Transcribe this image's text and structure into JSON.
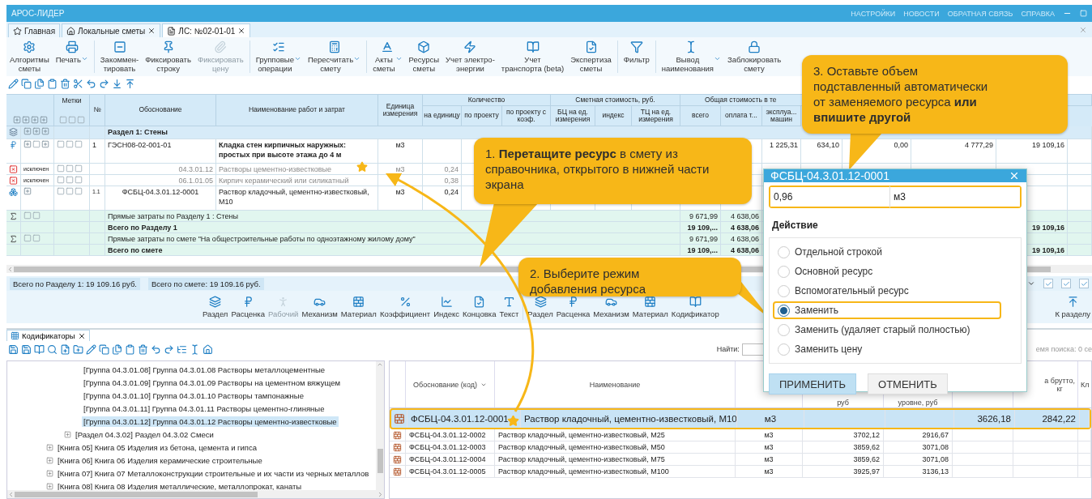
{
  "title_bar": {
    "title": "АРОС-ЛИДЕР",
    "menu": [
      "НАСТРОЙКИ",
      "НОВОСТИ",
      "ОБРАТНАЯ СВЯЗЬ",
      "СПРАВКА"
    ]
  },
  "tabs": [
    {
      "label": "Главная",
      "kind": "star",
      "closable": false,
      "selected": false
    },
    {
      "label": "Локальные сметы",
      "kind": "home",
      "closable": true,
      "selected": false
    },
    {
      "label": "ЛС: №02-01-01",
      "kind": "document",
      "closable": true,
      "selected": true
    }
  ],
  "ribbon": [
    {
      "label": "Алгоритмы\nсметы",
      "kind": "gear",
      "dropdown": false,
      "disabled": false
    },
    {
      "label": "Печать",
      "kind": "printer",
      "dropdown": true,
      "disabled": false
    },
    {
      "kind": "separator"
    },
    {
      "label": "Закоммен-\nтировать",
      "kind": "comment",
      "dropdown": false,
      "disabled": false
    },
    {
      "label": "Фиксировать\nстроку",
      "kind": "pin",
      "dropdown": false,
      "disabled": false
    },
    {
      "label": "Фиксировать\nцену",
      "kind": "clip",
      "dropdown": false,
      "disabled": true
    },
    {
      "kind": "separator"
    },
    {
      "label": "Групповые\nоперации",
      "kind": "list",
      "dropdown": true,
      "disabled": false
    },
    {
      "label": "Пересчитать\nсмету",
      "kind": "calc",
      "dropdown": true,
      "disabled": false
    },
    {
      "kind": "separator"
    },
    {
      "label": "Акты\nсметы",
      "kind": "letter",
      "dropdown": true,
      "disabled": false
    },
    {
      "label": "Ресурсы\nсметы",
      "kind": "box",
      "dropdown": false,
      "disabled": false
    },
    {
      "label": "Учет электро-\nэнергии",
      "kind": "bolt",
      "dropdown": false,
      "disabled": false
    },
    {
      "label": "Учет\nтранспорта (beta)",
      "kind": "book",
      "dropdown": false,
      "disabled": false
    },
    {
      "label": "Экспертиза\nсметы",
      "kind": "doc",
      "dropdown": false,
      "disabled": false
    },
    {
      "kind": "separator"
    },
    {
      "label": "Фильтр",
      "kind": "filter",
      "dropdown": false,
      "disabled": false
    },
    {
      "kind": "separator"
    },
    {
      "label": "Вывод\nнаименования",
      "kind": "cursor",
      "dropdown": true,
      "disabled": false
    },
    {
      "label": "Заблокировать\nсмету",
      "kind": "lock",
      "dropdown": false,
      "disabled": false
    }
  ],
  "table": {
    "columns": [
      "Метки",
      "№",
      "Обоснование",
      "Наименование работ и затрат",
      "Единица измерения"
    ],
    "groups": [
      {
        "label": "Количество",
        "columns": [
          "на единицу",
          "по проекту",
          "по проекту с коэф."
        ]
      },
      {
        "label": "Сметная стоимость, руб.",
        "columns": [
          "БЦ на ед. измерения",
          "индекс",
          "ТЦ на ед. измерения"
        ]
      },
      {
        "label": "Общая стоимость в те",
        "columns": [
          "всего",
          "оплата т...",
          "эксплуа... машин"
        ]
      }
    ],
    "rows": [
      {
        "kind": "section",
        "name": "Раздел 1: Стены"
      },
      {
        "kind": "rate",
        "number": "1",
        "code": "ГЭСН08-02-001-01",
        "name": "Кладка стен кирпичных наружных: простых при высоте этажа до 4 м",
        "unit": "м3",
        "machines": "1 225,31",
        "column_16": "634,10",
        "column_17": "0,00",
        "column_18": "4 777,29",
        "column_19": "19 109,16"
      },
      {
        "kind": "excluded",
        "status": "исключен",
        "code": "04.3.01.12",
        "name": "Растворы цементно-известковые",
        "unit": "м3",
        "per_unit": "0,24"
      },
      {
        "kind": "excluded",
        "status": "исключен",
        "code": "06.1.01.05",
        "name": "Кирпич керамический или силикатный",
        "per_unit": "0,38"
      },
      {
        "kind": "resource",
        "number": "1.1",
        "code": "ФСБЦ-04.3.01.12-0001",
        "name": "Раствор кладочный, цементно-известковый, М10",
        "unit": "м3",
        "per_unit": "0,24"
      },
      {
        "kind": "subtotal",
        "name": "Прямые затраты по Разделу 1 : Стены",
        "total_all": "9 671,99",
        "labor": "4 638,06"
      },
      {
        "kind": "total",
        "name": "Всего по Разделу 1",
        "total_all": "19 109,...",
        "labor": "4 638,06",
        "column_19": "19 109,16"
      },
      {
        "kind": "subtotal",
        "name": "Прямые затраты по смете \"На общестроительные работы по одноэтажному жилому дому\"",
        "total_all": "9 671,99",
        "labor": "4 638,06"
      },
      {
        "kind": "total",
        "name": "Всего по смете",
        "total_all": "19 109,...",
        "labor": "4 638,06",
        "column_19": "19 109,16"
      }
    ]
  },
  "status_bar": [
    "Всего по Разделу 1: 19 109.16 руб.",
    "Всего по смете: 19 109.16 руб."
  ],
  "bottom_ribbon": [
    {
      "label": "Раздел",
      "kind": "layers",
      "disabled": false
    },
    {
      "label": "Расценка",
      "kind": "ruble",
      "disabled": false
    },
    {
      "label": "Рабочий",
      "kind": "worker",
      "disabled": true
    },
    {
      "label": "Механизм",
      "kind": "car",
      "disabled": false
    },
    {
      "label": "Материал",
      "kind": "brick",
      "disabled": false
    },
    {
      "label": "Коэффициент",
      "kind": "percent",
      "disabled": false
    },
    {
      "label": "Индекс",
      "kind": "chart",
      "disabled": false
    },
    {
      "label": "Концовка",
      "kind": "doc",
      "disabled": false
    },
    {
      "label": "Текст",
      "kind": "text",
      "disabled": false
    },
    {
      "kind": "separator"
    },
    {
      "label": "Раздел",
      "kind": "layers",
      "disabled": false
    },
    {
      "label": "Расценка",
      "kind": "ruble",
      "disabled": false
    },
    {
      "label": "Механизм",
      "kind": "car",
      "disabled": false
    },
    {
      "label": "Материал",
      "kind": "brick",
      "disabled": false
    },
    {
      "label": "Кодификатор",
      "kind": "book",
      "disabled": false
    }
  ],
  "bottom_ribbon_right": {
    "label": "К разделу"
  },
  "codifiers": {
    "tab": "Кодификаторы",
    "search_label": "Найти:",
    "search_time": "емя поиска: 0 се",
    "tree": [
      {
        "children": [
          {
            "children": [
              {
                "label": "[Группа 04.3.01.08] Группа 04.3.01.08 Растворы металлоцементные",
                "selected": false
              },
              {
                "label": "[Группа 04.3.01.09] Группа 04.3.01.09 Растворы на цементном вяжущем",
                "selected": false
              },
              {
                "label": "[Группа 04.3.01.10] Группа 04.3.01.10 Растворы тампонажные",
                "selected": false
              },
              {
                "label": "[Группа 04.3.01.11] Группа 04.3.01.11 Растворы цементно-глиняные",
                "selected": false
              },
              {
                "label": "[Группа 04.3.01.12] Группа 04.3.01.12 Растворы цементно-известковые",
                "selected": true
              }
            ]
          },
          {
            "label": "[Раздел 04.3.02] Раздел 04.3.02 Смеси",
            "expanded": false,
            "selected": false
          }
        ]
      },
      {
        "label": "[Книга 05] Книга 05 Изделия из бетона, цемента и гипса",
        "expanded": false,
        "selected": false
      },
      {
        "label": "[Книга 06] Книга 06 Изделия керамические строительные",
        "expanded": false,
        "selected": false
      },
      {
        "label": "[Книга 07] Книга 07 Металлоконструкции строительные и их части из черных металлов",
        "expanded": false,
        "selected": false
      },
      {
        "label": "[Книга 08] Книга 08 Изделия металлические, металлопрокат, канаты",
        "expanded": false,
        "selected": false
      }
    ],
    "grid": {
      "columns": {
        "code": "Обоснование (код)",
        "name": "Наименование",
        "price_1": "руб",
        "price_2": "уровне, руб",
        "weight": "а брутто,\nкг",
        "last": "Кл"
      },
      "rows": [
        {
          "code": "ФСБЦ-04.3.01.12-0001",
          "name": "Раствор кладочный, цементно-известковый, М10",
          "unit": "м3",
          "price_3": "3626,18",
          "weight": "2842,22",
          "selected": true
        },
        {
          "code": "ФСБЦ-04.3.01.12-0002",
          "name": "Раствор кладочный, цементно-известковый, М25",
          "unit": "м3",
          "price_1": "3702,12",
          "price_2": "2916,67",
          "selected": false
        },
        {
          "code": "ФСБЦ-04.3.01.12-0003",
          "name": "Раствор кладочный, цементно-известковый, М50",
          "unit": "м3",
          "price_1": "3859,62",
          "price_2": "3071,08",
          "selected": false
        },
        {
          "code": "ФСБЦ-04.3.01.12-0004",
          "name": "Раствор кладочный, цементно-известковый, М75",
          "unit": "м3",
          "price_1": "3859,62",
          "price_2": "3071,08",
          "selected": false
        },
        {
          "code": "ФСБЦ-04.3.01.12-0005",
          "name": "Раствор кладочный, цементно-известковый, М100",
          "unit": "м3",
          "price_1": "3925,97",
          "price_2": "3136,13",
          "selected": false
        }
      ]
    }
  },
  "callouts": [
    "1. **Перетащите ресурс** в смету из справочника, открытого в нижней части экрана",
    "2. Выберите режим добавления ресурса",
    "3. Оставьте объем подставленный автоматически от заменяемого ресурса **или впишите другой**"
  ],
  "dialog": {
    "title": "ФСБЦ-04.3.01.12-0001",
    "value": "0,96",
    "unit": "м3",
    "section": "Действие",
    "options": [
      {
        "label": "Отдельной строкой",
        "selected": false
      },
      {
        "label": "Основной ресурс",
        "selected": false
      },
      {
        "label": "Вспомогательный ресурс",
        "selected": false
      },
      {
        "label": "Заменить",
        "selected": true
      },
      {
        "label": "Заменить (удаляет старый полностью)",
        "selected": false
      },
      {
        "label": "Заменить цену",
        "selected": false
      }
    ],
    "buttons": [
      {
        "label": "ПРИМЕНИТЬ",
        "primary": true
      },
      {
        "label": "ОТМЕНИТЬ",
        "primary": false
      }
    ]
  }
}
